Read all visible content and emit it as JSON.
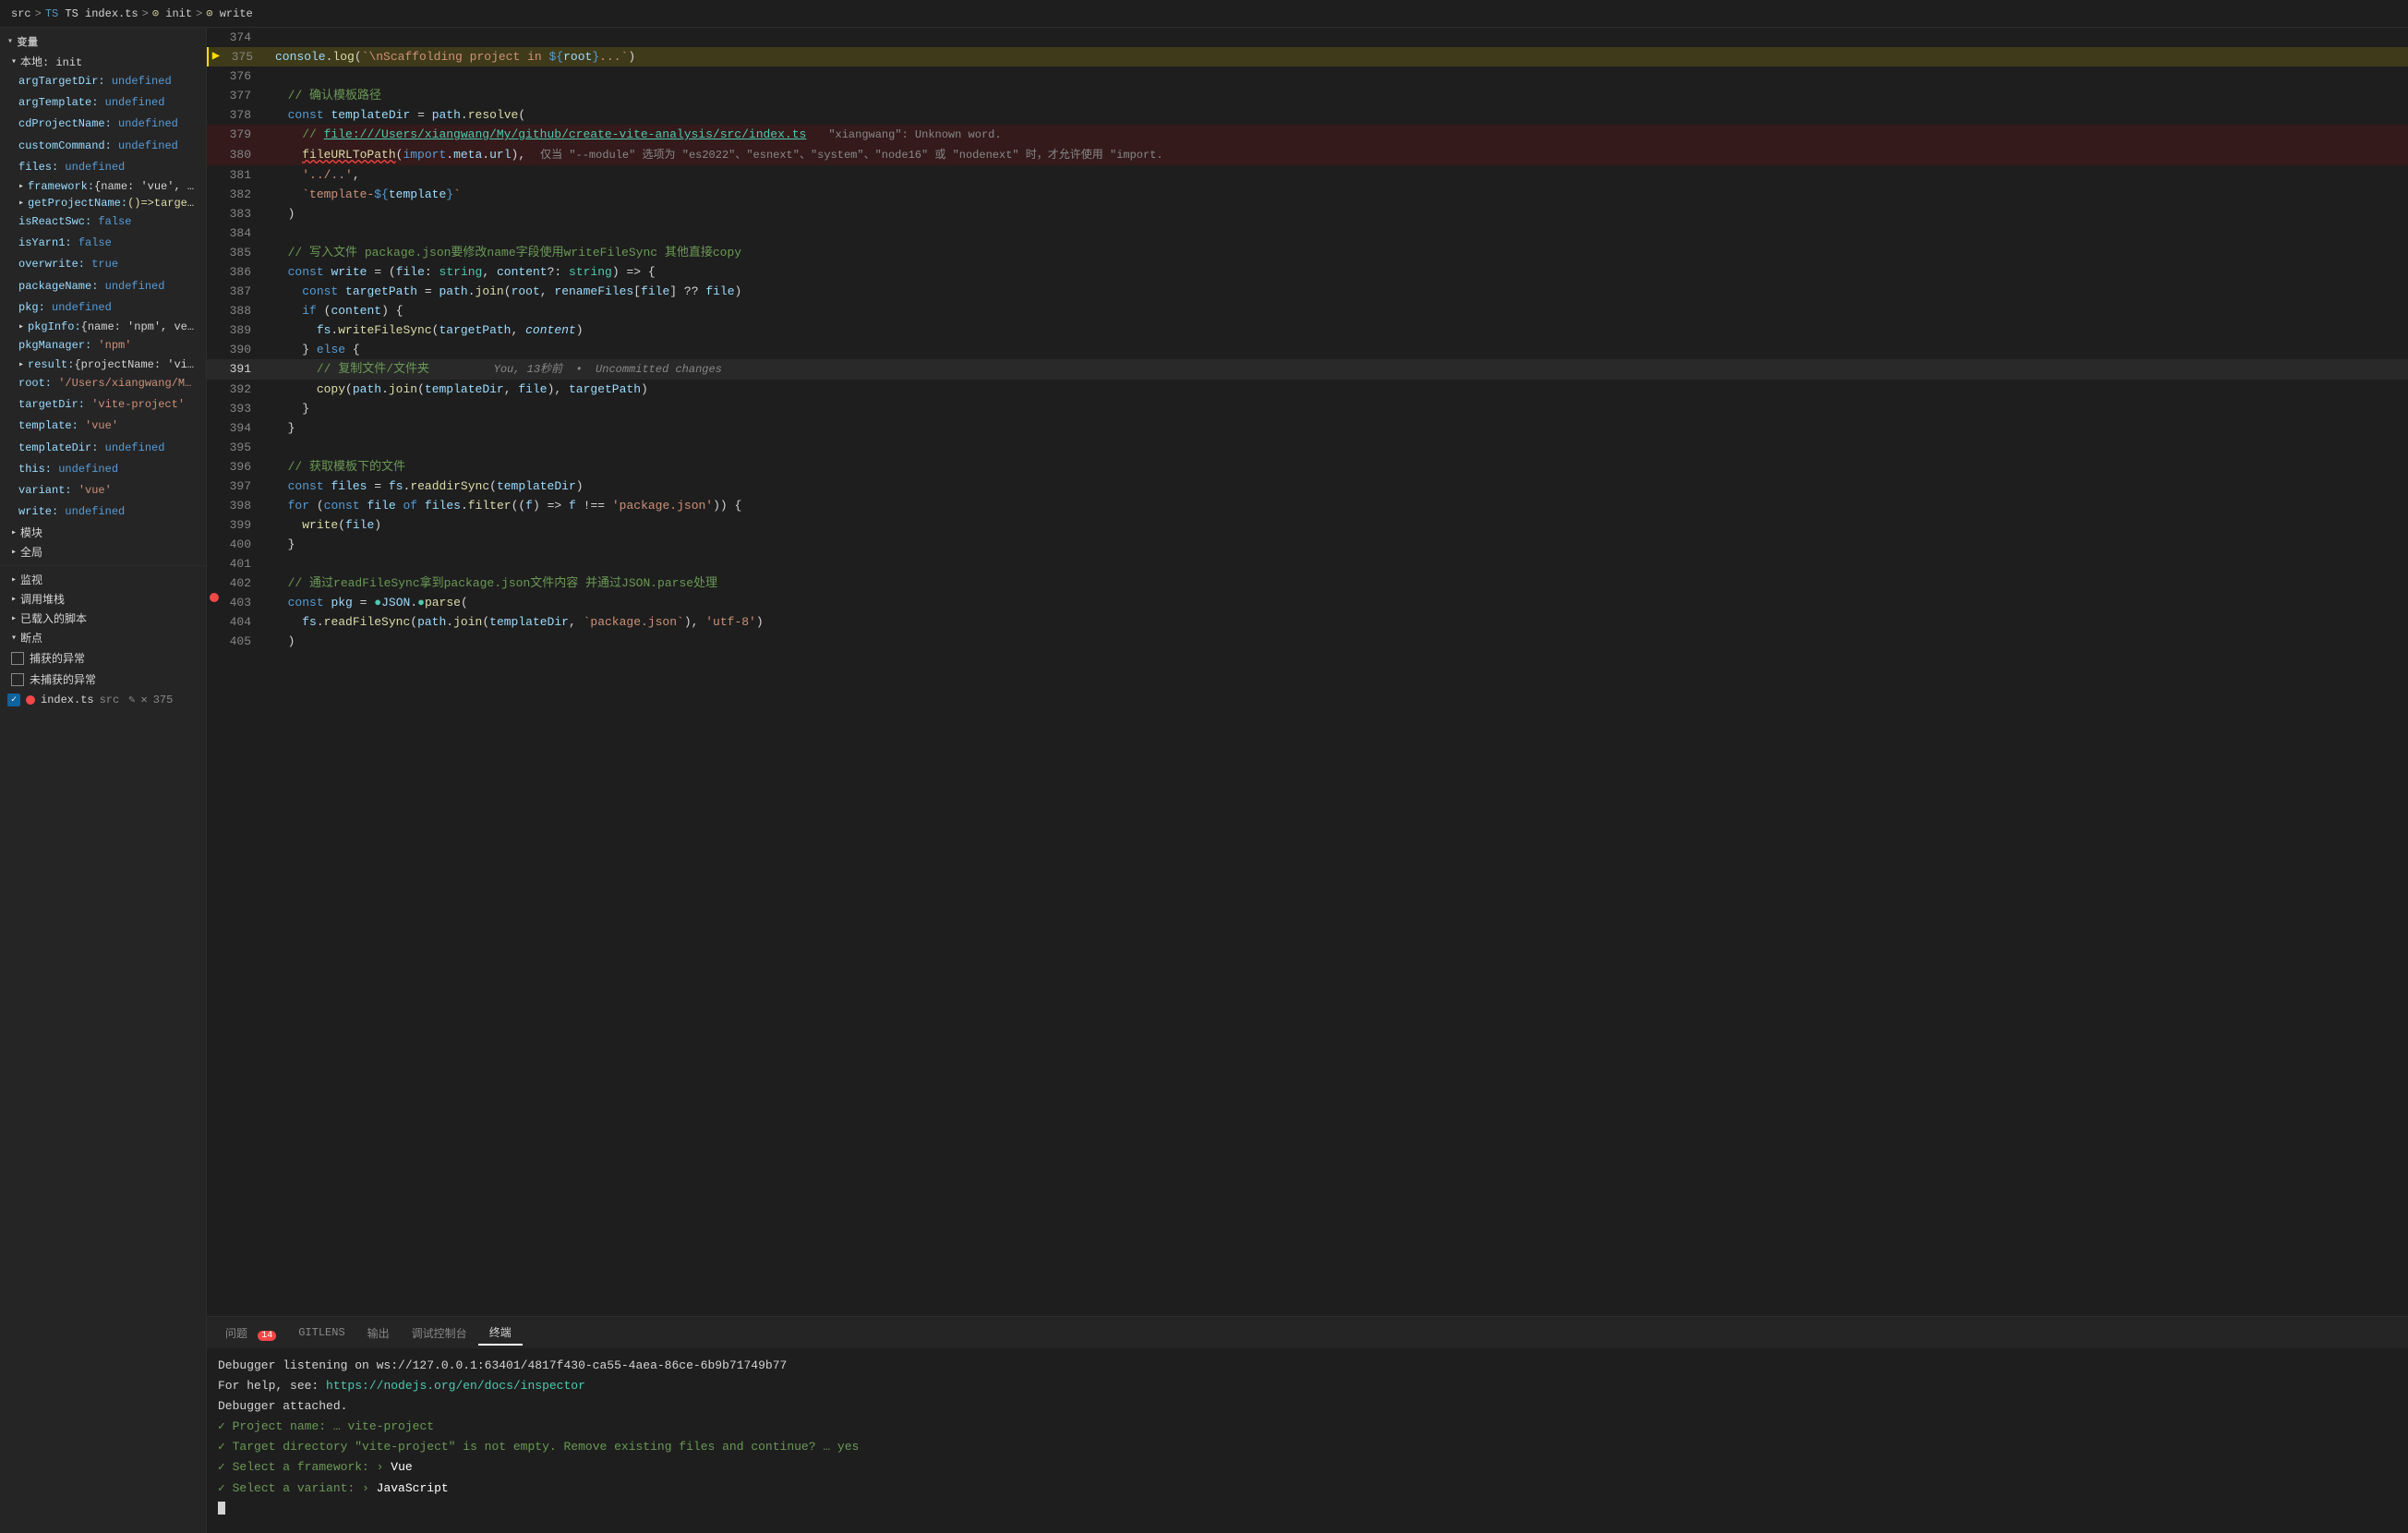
{
  "breadcrumb": {
    "src": "src",
    "sep1": ">",
    "ts_label": "TS index.ts",
    "sep2": ">",
    "init_label": "init",
    "sep3": ">",
    "write_label": "write"
  },
  "sidebar": {
    "variables_header": "变量",
    "local_header": "本地: init",
    "items": [
      {
        "key": "argTargetDir:",
        "value": "undefined",
        "type": "undefined"
      },
      {
        "key": "argTemplate:",
        "value": "undefined",
        "type": "undefined"
      },
      {
        "key": "cdProjectName:",
        "value": "undefined",
        "type": "undefined"
      },
      {
        "key": "customCommand:",
        "value": "undefined",
        "type": "undefined"
      },
      {
        "key": "files:",
        "value": "undefined",
        "type": "undefined"
      },
      {
        "key": "framework:",
        "value": "{name: 'vue', …",
        "type": "obj",
        "expandable": true
      },
      {
        "key": "getProjectName:",
        "value": "()=>targe…",
        "type": "func",
        "expandable": true
      },
      {
        "key": "isReactSwc:",
        "value": "false",
        "type": "false"
      },
      {
        "key": "isYarn1:",
        "value": "false",
        "type": "false"
      },
      {
        "key": "overwrite:",
        "value": "true",
        "type": "true"
      },
      {
        "key": "packageName:",
        "value": "undefined",
        "type": "undefined"
      },
      {
        "key": "pkg:",
        "value": "undefined",
        "type": "undefined"
      },
      {
        "key": "pkgInfo:",
        "value": "{name: 'npm', ve…",
        "type": "obj",
        "expandable": true
      },
      {
        "key": "pkgManager:",
        "value": "'npm'",
        "type": "string"
      },
      {
        "key": "result:",
        "value": "{projectName: 'vi…",
        "type": "obj",
        "expandable": true
      },
      {
        "key": "root:",
        "value": "'/Users/xiangwang/M…",
        "type": "string"
      },
      {
        "key": "targetDir:",
        "value": "'vite-project'",
        "type": "string"
      },
      {
        "key": "template:",
        "value": "'vue'",
        "type": "string"
      },
      {
        "key": "templateDir:",
        "value": "undefined",
        "type": "undefined"
      },
      {
        "key": "this:",
        "value": "undefined",
        "type": "undefined"
      },
      {
        "key": "variant:",
        "value": "'vue'",
        "type": "string"
      },
      {
        "key": "write:",
        "value": "undefined",
        "type": "undefined"
      }
    ],
    "modules_header": "模块",
    "global_header": "全局",
    "debug_sections": {
      "monitor_label": "监视",
      "callstack_label": "调用堆栈",
      "loaded_scripts_label": "已载入的脚本",
      "breakpoints_label": "断点",
      "capture_exceptions": "捕获的异常",
      "capture_uncaught": "未捕获的异常"
    },
    "breakpoint_file": "index.ts",
    "breakpoint_src": "src",
    "breakpoint_line": "375"
  },
  "code": {
    "lines": [
      {
        "num": 374,
        "content": "",
        "type": "normal"
      },
      {
        "num": 375,
        "content": "console.log(`\\nScaffolding project in ${root}...`)",
        "type": "debug-current",
        "has_debug_arrow": true
      },
      {
        "num": 376,
        "content": "",
        "type": "normal"
      },
      {
        "num": 377,
        "content": "  // 确认模板路径",
        "type": "normal"
      },
      {
        "num": 378,
        "content": "  const templateDir = path.resolve(",
        "type": "normal"
      },
      {
        "num": 379,
        "content": "    // file:///Users/xiangwang/My/github/create-vite-analysis/src/index.ts    \"xiangwang\": Unknown word.",
        "type": "error"
      },
      {
        "num": 380,
        "content": "    fileURLToPath(import.meta.url),    仅当 \"--module\" 选项为 \"es2022\"、\"esnext\"、\"system\"、\"node16\" 或 \"nodenext\" 时，才允许使用 \"import.",
        "type": "error"
      },
      {
        "num": 381,
        "content": "    '../..',",
        "type": "normal"
      },
      {
        "num": 382,
        "content": "    `template-${template}`",
        "type": "normal"
      },
      {
        "num": 383,
        "content": "  )",
        "type": "normal"
      },
      {
        "num": 384,
        "content": "",
        "type": "normal"
      },
      {
        "num": 385,
        "content": "  // 写入文件 package.json要修改name字段使用writeFileSync 其他直接copy",
        "type": "normal"
      },
      {
        "num": 386,
        "content": "  const write = (file: string, content?: string) => {",
        "type": "normal"
      },
      {
        "num": 387,
        "content": "    const targetPath = path.join(root, renameFiles[file] ?? file)",
        "type": "normal"
      },
      {
        "num": 388,
        "content": "    if (content) {",
        "type": "normal"
      },
      {
        "num": 389,
        "content": "      fs.writeFileSync(targetPath, content)",
        "type": "normal"
      },
      {
        "num": 390,
        "content": "    } else {",
        "type": "normal"
      },
      {
        "num": 391,
        "content": "      // 复制文件/文件夹        You, 13秒前  •  Uncommitted changes",
        "type": "active"
      },
      {
        "num": 392,
        "content": "      copy(path.join(templateDir, file), targetPath)",
        "type": "normal"
      },
      {
        "num": 393,
        "content": "    }",
        "type": "normal"
      },
      {
        "num": 394,
        "content": "  }",
        "type": "normal"
      },
      {
        "num": 395,
        "content": "",
        "type": "normal"
      },
      {
        "num": 396,
        "content": "  // 获取模板下的文件",
        "type": "normal"
      },
      {
        "num": 397,
        "content": "  const files = fs.readdirSync(templateDir)",
        "type": "normal"
      },
      {
        "num": 398,
        "content": "  for (const file of files.filter((f) => f !== 'package.json')) {",
        "type": "normal"
      },
      {
        "num": 399,
        "content": "    write(file)",
        "type": "normal"
      },
      {
        "num": 400,
        "content": "  }",
        "type": "normal"
      },
      {
        "num": 401,
        "content": "",
        "type": "normal"
      },
      {
        "num": 402,
        "content": "  // 通过readFileSync拿到package.json文件内容 并通过JSON.parse处理",
        "type": "normal"
      },
      {
        "num": 403,
        "content": "  const pkg = JSON.parse(",
        "type": "normal",
        "has_red_dot": true
      },
      {
        "num": 404,
        "content": "    fs.readFileSync(path.join(templateDir, `package.json`), 'utf-8')",
        "type": "normal"
      },
      {
        "num": 405,
        "content": "  )",
        "type": "normal"
      }
    ]
  },
  "panel_tabs": [
    {
      "id": "problems",
      "label": "问题",
      "badge": "14"
    },
    {
      "id": "gitlens",
      "label": "GITLENS"
    },
    {
      "id": "output",
      "label": "输出"
    },
    {
      "id": "debug-console",
      "label": "调试控制台"
    },
    {
      "id": "terminal",
      "label": "终端",
      "active": true
    }
  ],
  "terminal": {
    "lines": [
      "Debugger listening on ws://127.0.0.1:63401/4817f430-ca55-4aea-86ce-6b9b71749b77",
      "For help, see: https://nodejs.org/en/docs/inspector",
      "Debugger attached.",
      "✓ Project name: … vite-project",
      "✓ Target directory \"vite-project\" is not empty. Remove existing files and continue? … yes",
      "✓ Select a framework: › Vue",
      "✓ Select a variant: › JavaScript"
    ]
  },
  "error_hover": {
    "text": "Unknown"
  }
}
